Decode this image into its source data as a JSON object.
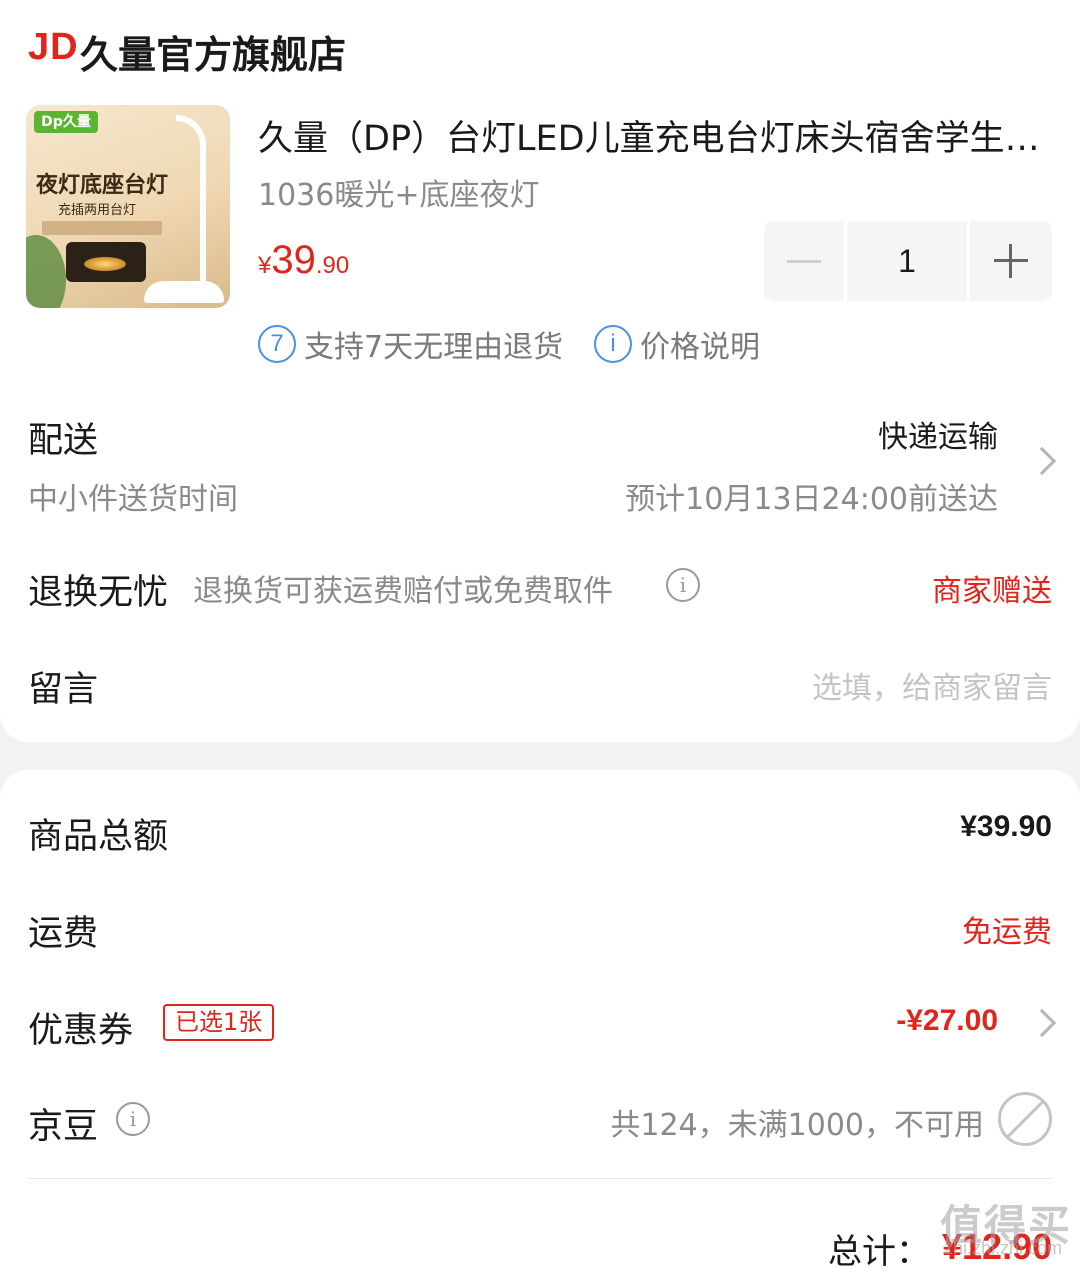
{
  "store": {
    "logo_text": "JD",
    "name": "久量官方旗舰店"
  },
  "product": {
    "image": {
      "brand_logo": "Dp久量",
      "headline": "夜灯底座台灯",
      "subline": "充插两用台灯"
    },
    "title": "久量（DP）台灯LED儿童充电台灯床头宿舍学生学习护眼台灯",
    "spec": "1036暖光+底座夜灯",
    "price": {
      "currency": "¥",
      "integer": "39",
      "decimal": ".90"
    },
    "quantity": "1",
    "services": [
      {
        "icon": "7",
        "icon_name": "seven-day-return-icon",
        "label": "支持7天无理由退货"
      },
      {
        "icon": "i",
        "icon_name": "info-icon",
        "label": "价格说明"
      }
    ]
  },
  "delivery": {
    "label": "配送",
    "sub_label": "中小件送货时间",
    "method": "快递运输",
    "eta": "预计10月13日24:00前送达"
  },
  "return_worry_free": {
    "label": "退换无忧",
    "description": "退换货可获运费赔付或免费取件",
    "status": "商家赠送"
  },
  "message": {
    "label": "留言",
    "placeholder": "选填，给商家留言"
  },
  "summary": {
    "goods_total_label": "商品总额",
    "goods_total": "¥39.90",
    "shipping_label": "运费",
    "shipping_value": "免运费",
    "coupon_label": "优惠券",
    "coupon_badge": "已选1张",
    "coupon_value": "-¥27.00",
    "jingdou_label": "京豆",
    "jingdou_info": "共124，未满1000，不可用",
    "total_label": "总计：",
    "total_value": "¥12.90"
  },
  "watermark": {
    "text": "值得买",
    "sub": "zhi.zhi.zhi.com"
  },
  "colors": {
    "accent_red": "#e1251b",
    "info_blue": "#4a90e2",
    "text_grey": "#8a8a8a"
  }
}
